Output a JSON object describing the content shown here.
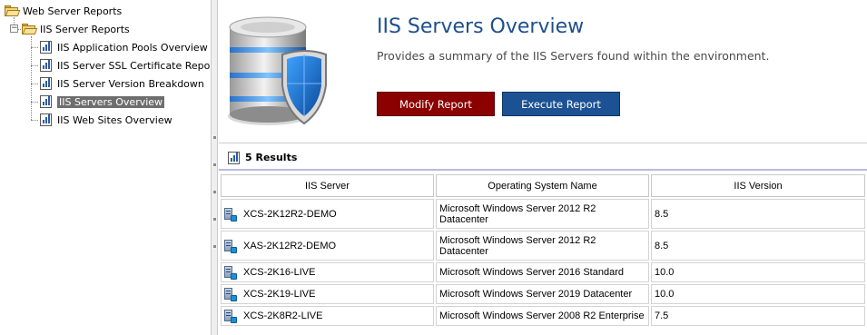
{
  "tree": {
    "root_label": "Web Server Reports",
    "group_label": "IIS Server Reports",
    "items": [
      {
        "label": "IIS Application Pools Overview",
        "selected": false
      },
      {
        "label": "IIS Server SSL Certificate Report",
        "selected": false
      },
      {
        "label": "IIS Server Version Breakdown",
        "selected": false
      },
      {
        "label": "IIS Servers Overview",
        "selected": true
      },
      {
        "label": "IIS Web Sites Overview",
        "selected": false
      }
    ]
  },
  "report": {
    "title": "IIS Servers Overview",
    "description": "Provides a summary of the IIS Servers found within the environment.",
    "modify_label": "Modify Report",
    "execute_label": "Execute Report"
  },
  "results": {
    "count_label": "5 Results",
    "columns": [
      "IIS Server",
      "Operating System Name",
      "IIS Version"
    ],
    "rows": [
      {
        "server": "XCS-2K12R2-DEMO",
        "os": "Microsoft Windows Server 2012 R2 Datacenter",
        "version": "8.5"
      },
      {
        "server": "XAS-2K12R2-DEMO",
        "os": "Microsoft Windows Server 2012 R2 Datacenter",
        "version": "8.5"
      },
      {
        "server": "XCS-2K16-LIVE",
        "os": "Microsoft Windows Server 2016 Standard",
        "version": "10.0"
      },
      {
        "server": "XCS-2K19-LIVE",
        "os": "Microsoft Windows Server 2019 Datacenter",
        "version": "10.0"
      },
      {
        "server": "XCS-2K8R2-LIVE",
        "os": "Microsoft Windows Server 2008 R2 Enterprise",
        "version": "7.5"
      }
    ]
  },
  "colors": {
    "title": "#1e4f8e",
    "modify_button": "#8b0000",
    "execute_button": "#1c5293",
    "selection": "#6e6e6e"
  }
}
